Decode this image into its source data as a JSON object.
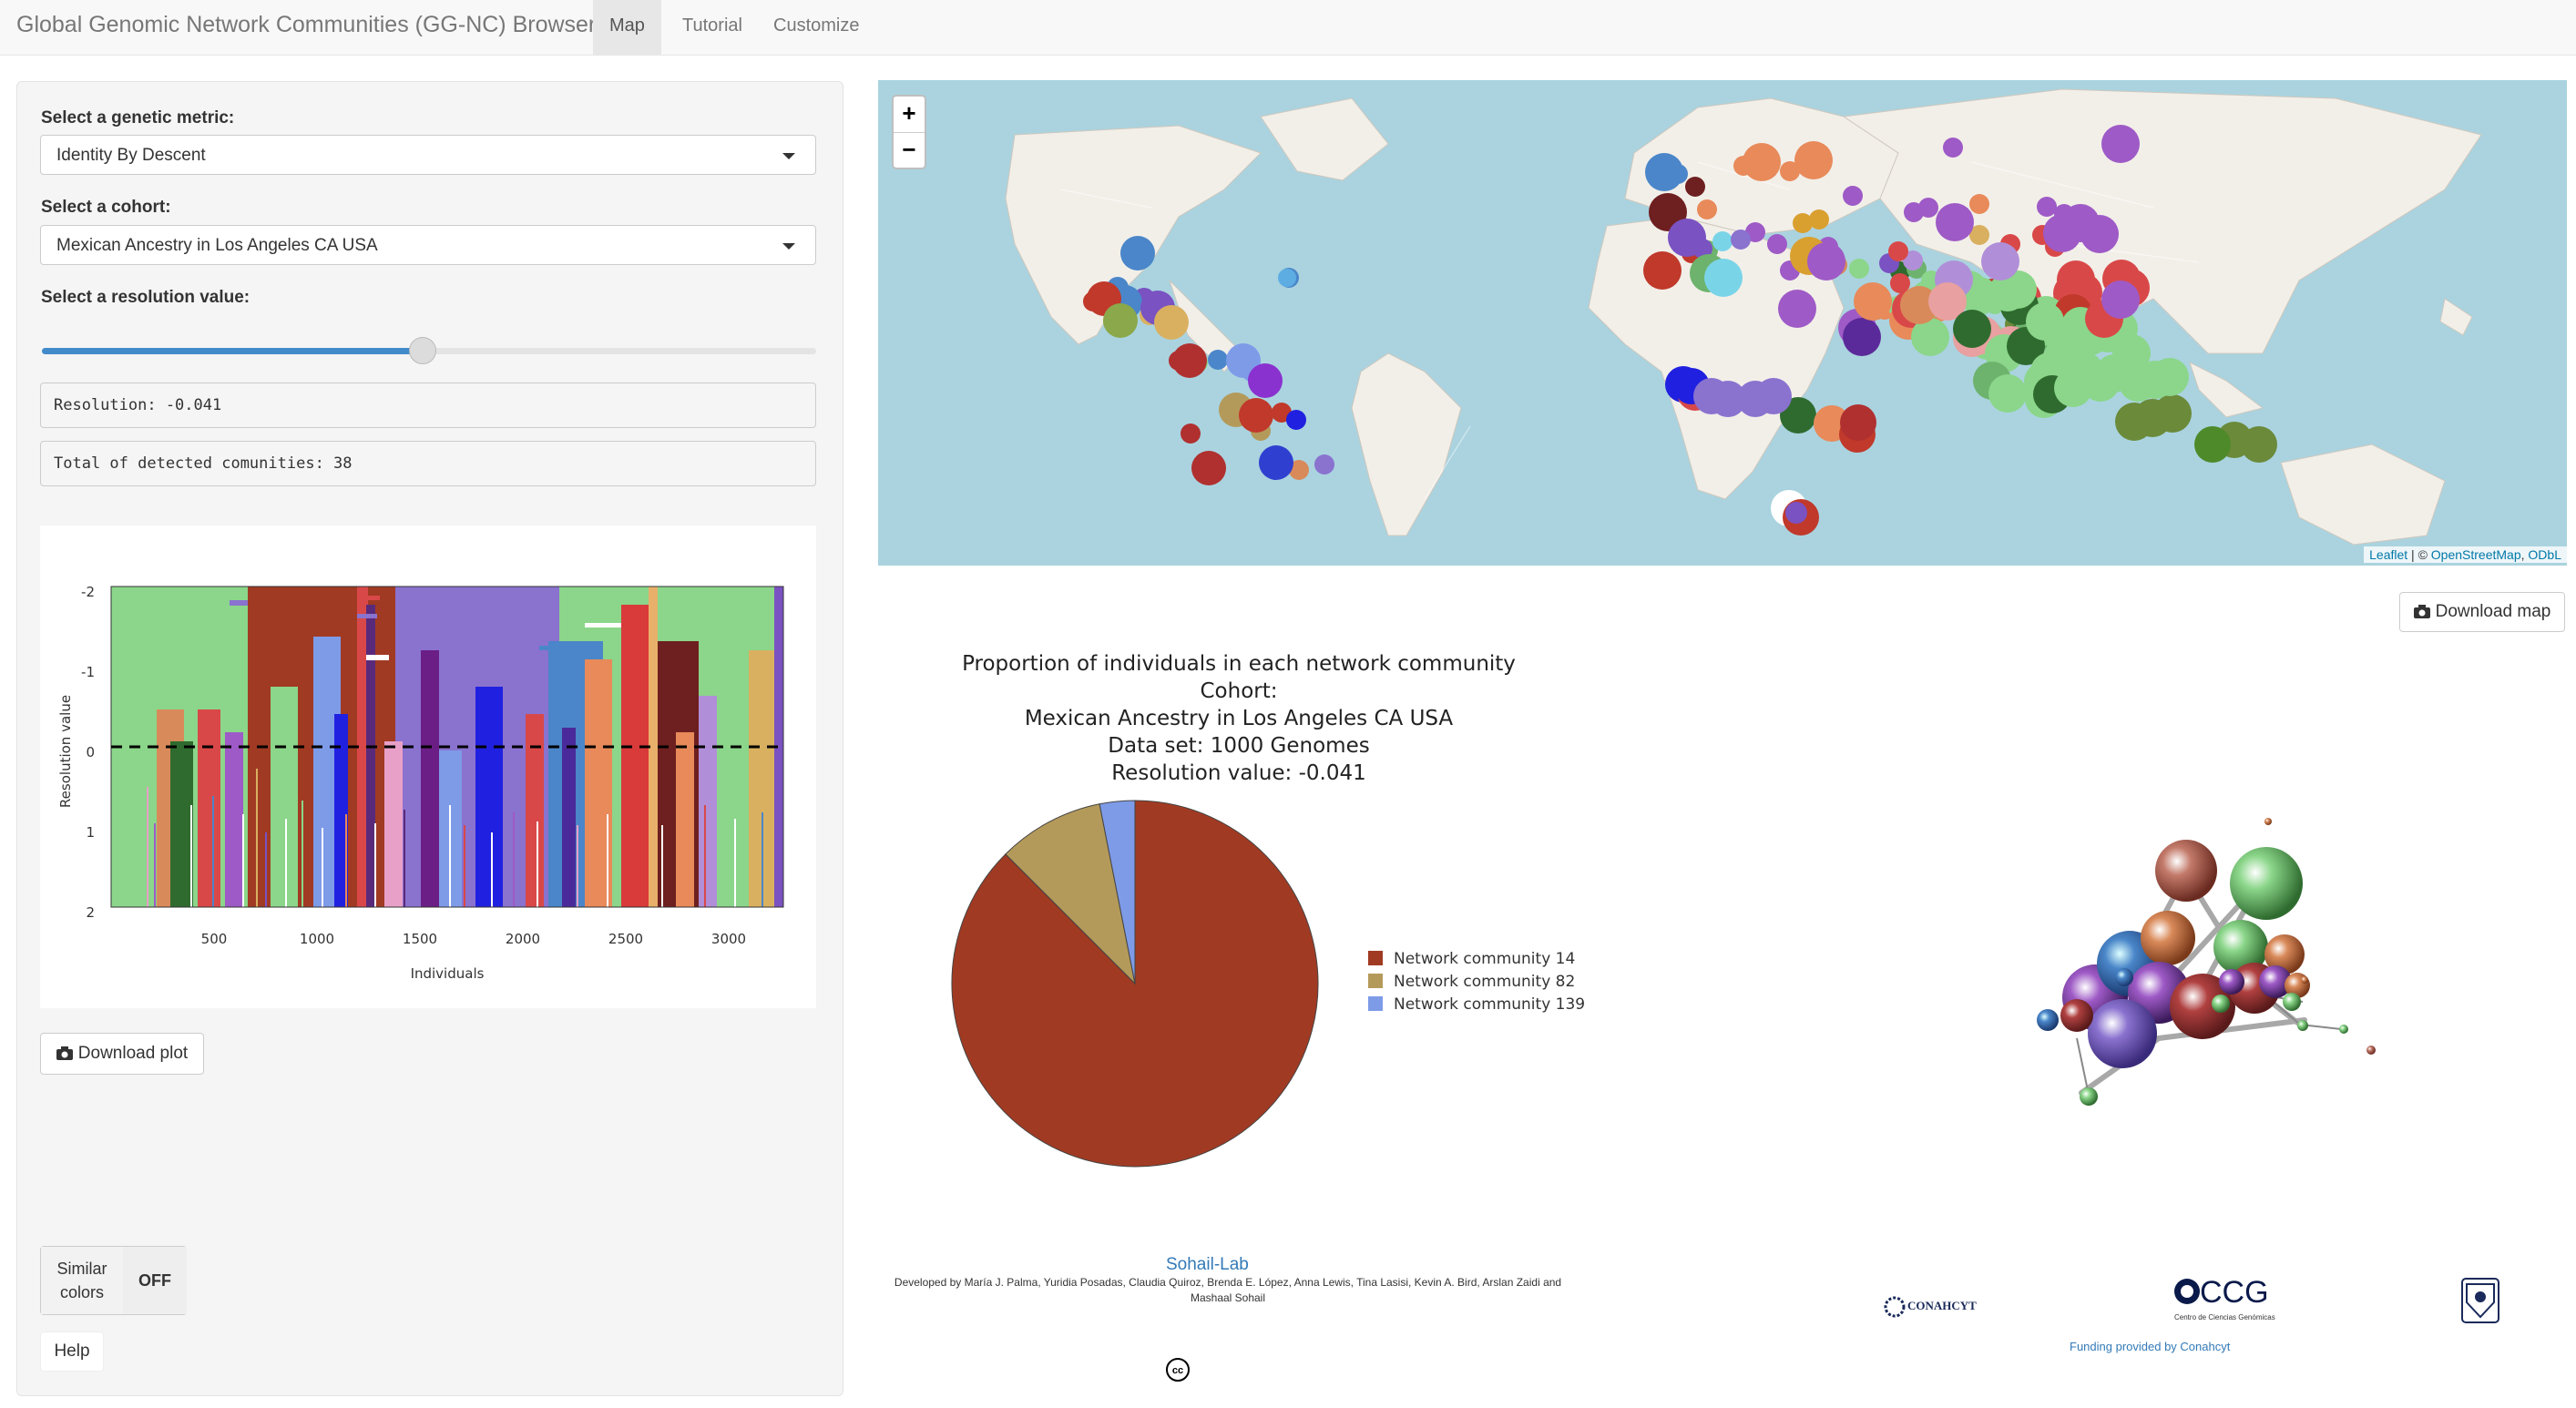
{
  "navbar": {
    "brand": "Global Genomic Network Communities (GG-NC) Browser",
    "tabs": [
      {
        "label": "Map",
        "active": true
      },
      {
        "label": "Tutorial",
        "active": false
      },
      {
        "label": "Customize",
        "active": false
      }
    ]
  },
  "sidebar": {
    "metric_label": "Select a genetic metric:",
    "metric_value": "Identity By Descent",
    "cohort_label": "Select a cohort:",
    "cohort_value": "Mexican Ancestry in Los Angeles CA USA",
    "resolution_label": "Select a resolution value:",
    "resolution_text": "Resolution: -0.041",
    "communities_text": "Total of detected comunities: 38",
    "download_plot": "Download plot",
    "similar_colors_label_1": "Similar",
    "similar_colors_label_2": "colors",
    "similar_colors_state": "OFF",
    "help": "Help"
  },
  "resolution_plot": {
    "ylabel": "Resolution value",
    "xlabel": "Individuals",
    "xticks": [
      "500",
      "1000",
      "1500",
      "2000",
      "2500",
      "3000"
    ],
    "yticks": [
      "-2",
      "-1",
      "0",
      "1",
      "2"
    ]
  },
  "map": {
    "zoom_in": "+",
    "zoom_out": "−",
    "attribution_leaflet": "Leaflet",
    "attribution_sep": " | © ",
    "attribution_osm": "OpenStreetMap",
    "attribution_odbl": "ODbL",
    "download_map": "Download map"
  },
  "pie_title": [
    "Proportion of individuals in each network community",
    "Cohort:",
    "Mexican Ancestry in Los Angeles CA USA",
    "Data set: 1000 Genomes",
    "Resolution value:  -0.041"
  ],
  "chart_data": {
    "type": "pie",
    "title": "Proportion of individuals in each network community",
    "categories": [
      "Network community 14",
      "Network community 82",
      "Network community 139"
    ],
    "values": [
      0.875,
      0.094,
      0.031
    ],
    "colors": [
      "#A13A23",
      "#B49A5A",
      "#7E9BE8"
    ]
  },
  "footer": {
    "lab_link": "Sohail-Lab",
    "credits": "Developed by María J. Palma, Yuridia Posadas, Claudia Quiroz, Brenda E. López, Anna Lewis, Tina Lasisi, Kevin A. Bird, Arslan Zaidi and Mashaal Sohail",
    "cc": "cc",
    "funding": "Funding provided by Conahcyt",
    "logo_conahcyt": "CONAHCYT",
    "logo_ccg": "CCG",
    "logo_ccg_sub": "Centro de Ciencias Genómicas"
  }
}
